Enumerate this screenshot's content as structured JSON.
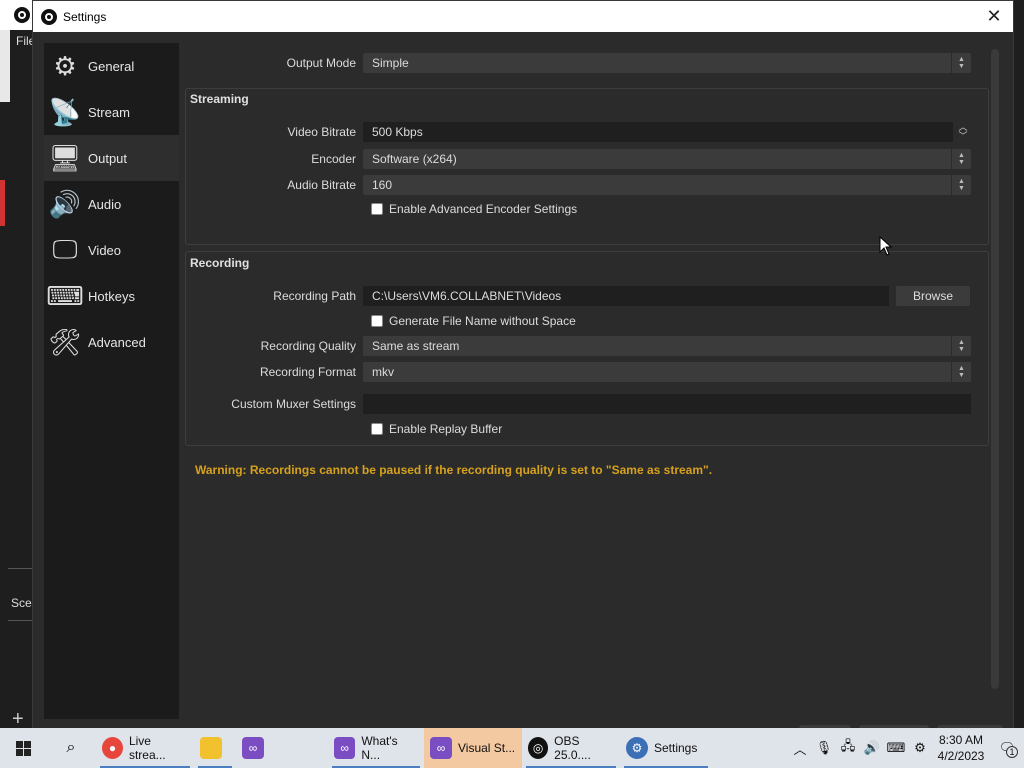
{
  "window": {
    "title": "Settings",
    "close_glyph": "✕"
  },
  "background_app": {
    "menu_text": "File",
    "scenes_text": "Scen",
    "add_glyph": "+"
  },
  "sidebar": {
    "items": [
      {
        "label": "General",
        "icon": "gear-icon",
        "glyph": "⚙"
      },
      {
        "label": "Stream",
        "icon": "broadcast-icon",
        "glyph": "📡"
      },
      {
        "label": "Output",
        "icon": "monitor-output-icon",
        "glyph": "🖥"
      },
      {
        "label": "Audio",
        "icon": "speaker-icon",
        "glyph": "🔊"
      },
      {
        "label": "Video",
        "icon": "monitor-icon",
        "glyph": "🖵"
      },
      {
        "label": "Hotkeys",
        "icon": "keyboard-icon",
        "glyph": "⌨"
      },
      {
        "label": "Advanced",
        "icon": "tools-icon",
        "glyph": "🛠"
      }
    ],
    "active": "Output"
  },
  "output": {
    "output_mode_label": "Output Mode",
    "output_mode_value": "Simple",
    "streaming": {
      "title": "Streaming",
      "video_bitrate_label": "Video Bitrate",
      "video_bitrate_value": "500 Kbps",
      "encoder_label": "Encoder",
      "encoder_value": "Software (x264)",
      "audio_bitrate_label": "Audio Bitrate",
      "audio_bitrate_value": "160",
      "advanced_encoder_label": "Enable Advanced Encoder Settings"
    },
    "recording": {
      "title": "Recording",
      "path_label": "Recording Path",
      "path_value": "C:\\Users\\VM6.COLLABNET\\Videos",
      "browse_label": "Browse",
      "no_space_label": "Generate File Name without Space",
      "quality_label": "Recording Quality",
      "quality_value": "Same as stream",
      "format_label": "Recording Format",
      "format_value": "mkv",
      "muxer_label": "Custom Muxer Settings",
      "muxer_value": "",
      "replay_label": "Enable Replay Buffer"
    },
    "warning": "Warning: Recordings cannot be paused if the recording quality is set to \"Same as stream\"."
  },
  "taskbar": {
    "apps": [
      {
        "label": "Live strea...",
        "icon": "chrome-icon",
        "color": "#e8453c"
      },
      {
        "label": "",
        "icon": "file-explorer-icon",
        "color": "#f2c12e"
      },
      {
        "label": "",
        "icon": "visual-studio-icon",
        "color": "#7a4ec2"
      },
      {
        "label": "What's N...",
        "icon": "visual-studio-icon",
        "color": "#7a4ec2"
      },
      {
        "label": "Visual St...",
        "icon": "visual-studio-icon",
        "color": "#7a4ec2"
      },
      {
        "label": "OBS 25.0....",
        "icon": "obs-icon",
        "color": "#111111"
      },
      {
        "label": "Settings",
        "icon": "settings-gear-icon",
        "color": "#3b6fb6"
      }
    ],
    "clock_time": "8:30 AM",
    "clock_date": "4/2/2023",
    "notification_count": "1"
  },
  "colors": {
    "warning": "#d6a11e",
    "sidebar_bg": "#1b1b1b",
    "window_bg": "#2b2b2b",
    "active_taskbar": "#f3c9a2"
  }
}
